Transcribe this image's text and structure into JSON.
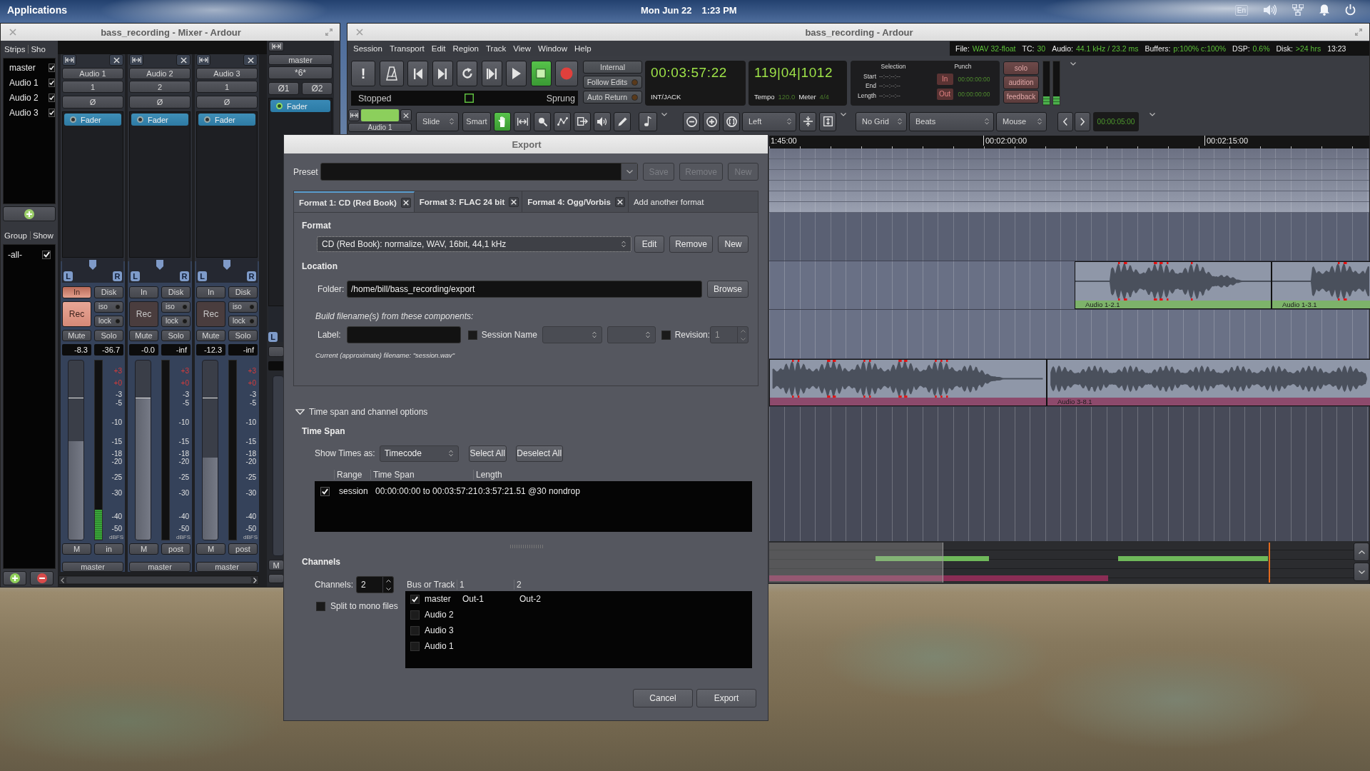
{
  "desktop": {
    "panel": {
      "menu": "Applications",
      "date": "Mon Jun 22",
      "time": "1:23 PM",
      "keyboard_layout": "En"
    }
  },
  "mixer": {
    "title": "bass_recording - Mixer - Ardour",
    "strips_list": {
      "headers": [
        "Strips",
        "Sho"
      ],
      "items": [
        {
          "name": "master",
          "checked": true
        },
        {
          "name": "Audio 1",
          "checked": true
        },
        {
          "name": "Audio 2",
          "checked": true
        },
        {
          "name": "Audio 3",
          "checked": true
        }
      ]
    },
    "groups_list": {
      "headers": [
        "Group",
        "Show"
      ],
      "items": [
        {
          "name": "-all-",
          "checked": true
        }
      ]
    },
    "strips": [
      {
        "name": "Audio 1",
        "input": "1",
        "phase": "Ø",
        "processor": {
          "label": "Fader",
          "on": false
        },
        "pan": [
          "L",
          "R"
        ],
        "monitor_in": {
          "label": "In",
          "on": true
        },
        "monitor_disk": {
          "label": "Disk",
          "on": false
        },
        "rec": {
          "label": "Rec",
          "armed": true
        },
        "iso": "iso",
        "lock": "lock",
        "mute": "Mute",
        "solo": "Solo",
        "gain": "-8.3",
        "peak": "-36.7",
        "fader": {
          "level": 0.55
        },
        "meter": {
          "level": 0.17
        },
        "scale": [
          "+3",
          "+0",
          "-3",
          "-5",
          "-10",
          "-15",
          "-18",
          "-20",
          "-25",
          "-30",
          "-40",
          "-50"
        ],
        "scale_unit": "dBFS",
        "meter_button": "M",
        "meter_point": "in",
        "output": "master"
      },
      {
        "name": "Audio 2",
        "input": "2",
        "phase": "Ø",
        "processor": {
          "label": "Fader",
          "on": false
        },
        "pan": [
          "L",
          "R"
        ],
        "monitor_in": {
          "label": "In",
          "on": false
        },
        "monitor_disk": {
          "label": "Disk",
          "on": false
        },
        "rec": {
          "label": "Rec",
          "armed": false
        },
        "iso": "iso",
        "lock": "lock",
        "mute": "Mute",
        "solo": "Solo",
        "gain": "-0.0",
        "peak": "-inf",
        "fader": {
          "level": 0.79
        },
        "meter": {
          "level": 0
        },
        "scale": [
          "+3",
          "+0",
          "-3",
          "-5",
          "-10",
          "-15",
          "-18",
          "-20",
          "-25",
          "-30",
          "-40",
          "-50"
        ],
        "scale_unit": "dBFS",
        "meter_button": "M",
        "meter_point": "post",
        "output": "master"
      },
      {
        "name": "Audio 3",
        "input": "1",
        "phase": "Ø",
        "processor": {
          "label": "Fader",
          "on": false
        },
        "pan": [
          "L",
          "R"
        ],
        "monitor_in": {
          "label": "In",
          "on": false
        },
        "monitor_disk": {
          "label": "Disk",
          "on": false
        },
        "rec": {
          "label": "Rec",
          "armed": false
        },
        "iso": "iso",
        "lock": "lock",
        "mute": "Mute",
        "solo": "Solo",
        "gain": "-12.3",
        "peak": "-inf",
        "fader": {
          "level": 0.46
        },
        "meter": {
          "level": 0
        },
        "scale": [
          "+3",
          "+0",
          "-3",
          "-5",
          "-10",
          "-15",
          "-18",
          "-20",
          "-25",
          "-30",
          "-40",
          "-50"
        ],
        "scale_unit": "dBFS",
        "meter_button": "M",
        "meter_point": "post",
        "output": "master"
      }
    ],
    "master_strip": {
      "name": "master",
      "input": "*6*",
      "phase": [
        "Ø1",
        "Ø2"
      ],
      "processor": {
        "label": "Fader",
        "on": true
      },
      "pan": "L",
      "meter_button": "M"
    }
  },
  "editor": {
    "title": "bass_recording - Ardour",
    "menu": [
      "Session",
      "Transport",
      "Edit",
      "Region",
      "Track",
      "View",
      "Window",
      "Help"
    ],
    "status": {
      "items": [
        {
          "label": "File:",
          "value": "WAV 32-float"
        },
        {
          "label": "TC:",
          "value": "30"
        },
        {
          "label": "Audio:",
          "value": "44.1 kHz / 23.2 ms"
        },
        {
          "label": "Buffers:",
          "value": "p:100% c:100%"
        },
        {
          "label": "DSP:",
          "value": "0.6%"
        },
        {
          "label": "Disk:",
          "value": ">24 hrs"
        }
      ],
      "clock": "13:23"
    },
    "transport": {
      "buttons": [
        {
          "label": "!",
          "active": false
        },
        {
          "active": false
        },
        {
          "active": false
        },
        {
          "active": false
        },
        {
          "active": false
        },
        {
          "active": false
        },
        {
          "active": false
        },
        {
          "active": true
        },
        {
          "active": false
        }
      ],
      "shuttle": {
        "state": "Stopped",
        "mode": "Sprung"
      },
      "sync_buttons": [
        "Internal",
        "Follow Edits",
        "Auto Return"
      ],
      "primary_clock": {
        "time": "00:03:57:22",
        "source": "INT/JACK"
      },
      "secondary_clock": {
        "bbt": "119|04|1012",
        "tempo_label": "Tempo",
        "tempo": "120.0",
        "meter_label": "Meter",
        "meter": "4/4"
      },
      "selection": {
        "title": "Selection",
        "rows": [
          {
            "label": "Start",
            "value": "--:--:--:--"
          },
          {
            "label": "End",
            "value": "--:--:--:--"
          },
          {
            "label": "Length",
            "value": "--:--:--:--"
          }
        ]
      },
      "punch": {
        "title": "Punch",
        "rows": [
          {
            "label": "In",
            "value": "00:00:00:00"
          },
          {
            "label": "Out",
            "value": "00:00:00:00"
          }
        ]
      },
      "monitor_buttons": [
        "solo",
        "audition",
        "feedback"
      ],
      "meters": [
        {
          "level": 0.2
        },
        {
          "level": 0.2
        }
      ]
    },
    "edit_toolbar": {
      "mini_strip": {
        "name": "Audio 1",
        "color": "#8ccf5c"
      },
      "edit_mode": "Slide",
      "tools": [
        {
          "label": "Smart",
          "selected": false
        },
        {
          "selected": true
        },
        {
          "selected": false
        },
        {
          "selected": false
        },
        {
          "selected": false
        },
        {
          "selected": false
        },
        {
          "selected": false
        },
        {
          "selected": false
        }
      ],
      "zoom_focus": "Left",
      "grid": "No Grid",
      "grid_units": "Beats",
      "edit_point": "Mouse",
      "nudge": "00:00:05:00"
    },
    "canvas": {
      "ruler": [
        "1:45:00",
        "00:02:00:00",
        "00:02:15:00"
      ],
      "region_tracks": [
        {
          "regions": [
            {
              "name": "Audio 1-2.1",
              "color": "#7db36a"
            },
            {
              "name": "Audio 1-3.1",
              "color": "#7db36a"
            }
          ]
        },
        {
          "regions": [
            {
              "color": "#8d4a6c"
            },
            {
              "name": "Audio 3-8.1",
              "color": "#8d4a6c"
            }
          ]
        }
      ]
    }
  },
  "export_dialog": {
    "title": "Export",
    "preset": {
      "label": "Preset",
      "buttons": [
        {
          "label": "Save",
          "disabled": true
        },
        {
          "label": "Remove",
          "disabled": true
        },
        {
          "label": "New",
          "disabled": true
        }
      ]
    },
    "tabs": [
      {
        "label": "Format 1: CD (Red Book)",
        "selected": true,
        "closable": true
      },
      {
        "label": "Format 3: FLAC 24 bit",
        "selected": false,
        "closable": true
      },
      {
        "label": "Format 4: Ogg/Vorbis",
        "selected": false,
        "closable": true
      },
      {
        "label": "Add another format",
        "selected": false,
        "closable": false
      }
    ],
    "format": {
      "heading": "Format",
      "value": "CD (Red Book): normalize, WAV, 16bit, 44,1 kHz",
      "buttons": [
        "Edit",
        "Remove",
        "New"
      ]
    },
    "location": {
      "heading": "Location",
      "folder_label": "Folder:",
      "folder": "/home/bill/bass_recording/export",
      "browse": "Browse",
      "hint": "Build filename(s) from these components:",
      "label_label": "Label:",
      "session_name": {
        "label": "Session Name",
        "checked": false
      },
      "revision": {
        "label": "Revision:",
        "checked": false,
        "value": "1"
      },
      "current": "Current (approximate) filename: \"session.wav\""
    },
    "options": {
      "label": "Time span and channel options",
      "expanded": true
    },
    "time_span": {
      "heading": "Time Span",
      "show_label": "Show Times as:",
      "show_value": "Timecode",
      "buttons": [
        "Select All",
        "Deselect All"
      ],
      "columns": [
        "Range",
        "Time Span",
        "Length"
      ],
      "rows": [
        {
          "checked": true,
          "range": "session",
          "span": "00:00:00:00 to 00:03:57:21",
          "length": "0:3:57:21.51 @30 nondrop"
        }
      ]
    },
    "channels": {
      "heading": "Channels",
      "count_label": "Channels:",
      "count": "2",
      "split": {
        "label": "Split to mono files",
        "checked": false
      },
      "columns": [
        "Bus or Track",
        "1",
        "2"
      ],
      "rows": [
        {
          "name": "master",
          "checked": true,
          "ports": [
            "Out-1",
            "Out-2"
          ]
        },
        {
          "name": "Audio 2",
          "checked": false
        },
        {
          "name": "Audio 3",
          "checked": false
        },
        {
          "name": "Audio 1",
          "checked": false
        }
      ]
    },
    "buttons": [
      "Cancel",
      "Export"
    ]
  }
}
